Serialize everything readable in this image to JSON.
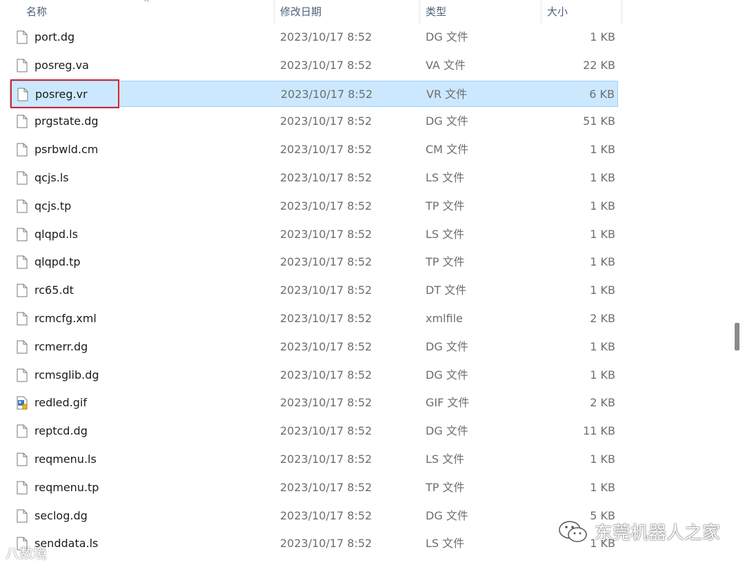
{
  "header": {
    "name": "名称",
    "date": "修改日期",
    "type": "类型",
    "size": "大小"
  },
  "files": [
    {
      "name": "port.dg",
      "date": "2023/10/17 8:52",
      "type": "DG 文件",
      "size": "1 KB",
      "icon": "file-icon"
    },
    {
      "name": "posreg.va",
      "date": "2023/10/17 8:52",
      "type": "VA 文件",
      "size": "22 KB",
      "icon": "file-icon"
    },
    {
      "name": "posreg.vr",
      "date": "2023/10/17 8:52",
      "type": "VR 文件",
      "size": "6 KB",
      "icon": "file-icon",
      "selected": true
    },
    {
      "name": "prgstate.dg",
      "date": "2023/10/17 8:52",
      "type": "DG 文件",
      "size": "51 KB",
      "icon": "file-icon"
    },
    {
      "name": "psrbwld.cm",
      "date": "2023/10/17 8:52",
      "type": "CM 文件",
      "size": "1 KB",
      "icon": "file-icon"
    },
    {
      "name": "qcjs.ls",
      "date": "2023/10/17 8:52",
      "type": "LS 文件",
      "size": "1 KB",
      "icon": "file-icon"
    },
    {
      "name": "qcjs.tp",
      "date": "2023/10/17 8:52",
      "type": "TP 文件",
      "size": "1 KB",
      "icon": "file-icon"
    },
    {
      "name": "qlqpd.ls",
      "date": "2023/10/17 8:52",
      "type": "LS 文件",
      "size": "1 KB",
      "icon": "file-icon"
    },
    {
      "name": "qlqpd.tp",
      "date": "2023/10/17 8:52",
      "type": "TP 文件",
      "size": "1 KB",
      "icon": "file-icon"
    },
    {
      "name": "rc65.dt",
      "date": "2023/10/17 8:52",
      "type": "DT 文件",
      "size": "1 KB",
      "icon": "file-icon"
    },
    {
      "name": "rcmcfg.xml",
      "date": "2023/10/17 8:52",
      "type": "xmlfile",
      "size": "2 KB",
      "icon": "file-icon"
    },
    {
      "name": "rcmerr.dg",
      "date": "2023/10/17 8:52",
      "type": "DG 文件",
      "size": "1 KB",
      "icon": "file-icon"
    },
    {
      "name": "rcmsglib.dg",
      "date": "2023/10/17 8:52",
      "type": "DG 文件",
      "size": "1 KB",
      "icon": "file-icon"
    },
    {
      "name": "redled.gif",
      "date": "2023/10/17 8:52",
      "type": "GIF 文件",
      "size": "2 KB",
      "icon": "image-file-icon"
    },
    {
      "name": "reptcd.dg",
      "date": "2023/10/17 8:52",
      "type": "DG 文件",
      "size": "11 KB",
      "icon": "file-icon"
    },
    {
      "name": "reqmenu.ls",
      "date": "2023/10/17 8:52",
      "type": "LS 文件",
      "size": "1 KB",
      "icon": "file-icon"
    },
    {
      "name": "reqmenu.tp",
      "date": "2023/10/17 8:52",
      "type": "TP 文件",
      "size": "1 KB",
      "icon": "file-icon"
    },
    {
      "name": "seclog.dg",
      "date": "2023/10/17 8:52",
      "type": "DG 文件",
      "size": "5 KB",
      "icon": "file-icon"
    },
    {
      "name": "senddata.ls",
      "date": "2023/10/17 8:52",
      "type": "LS 文件",
      "size": "1 KB",
      "icon": "file-icon"
    }
  ],
  "watermark": "东莞机器人之家",
  "watermark2": "八数境",
  "colors": {
    "selection_bg": "#cce8ff",
    "selection_border": "#99d1ff",
    "highlight_box": "#d9242b"
  }
}
